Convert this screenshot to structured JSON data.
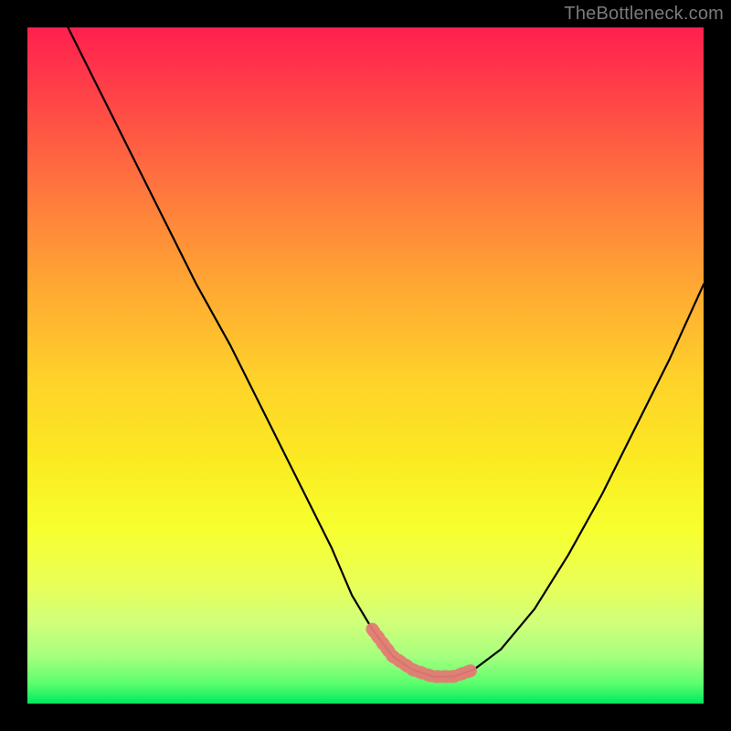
{
  "watermark": "TheBottleneck.com",
  "chart_data": {
    "type": "line",
    "title": "",
    "xlabel": "",
    "ylabel": "",
    "xlim": [
      0,
      100
    ],
    "ylim": [
      0,
      100
    ],
    "series": [
      {
        "name": "curve",
        "x": [
          6,
          10,
          15,
          20,
          25,
          30,
          35,
          40,
          45,
          48,
          51,
          54,
          57,
          60,
          63,
          66,
          70,
          75,
          80,
          85,
          90,
          95,
          100
        ],
        "y": [
          100,
          92,
          82,
          72,
          62,
          53,
          43,
          33,
          23,
          16,
          11,
          7,
          5,
          4,
          4,
          5,
          8,
          14,
          22,
          31,
          41,
          51,
          62
        ]
      }
    ],
    "highlight_band": {
      "name": "bottom-fuzzy-segment",
      "x": [
        51,
        54,
        57,
        60,
        63,
        66
      ],
      "y": [
        11,
        7,
        5,
        4,
        4,
        5
      ],
      "color": "#e47a74"
    },
    "background_gradient_stops": [
      {
        "pos": 0,
        "color": "#ff1f4f"
      },
      {
        "pos": 25,
        "color": "#ff7a3d"
      },
      {
        "pos": 52,
        "color": "#ffd22a"
      },
      {
        "pos": 74,
        "color": "#f7ff2e"
      },
      {
        "pos": 93,
        "color": "#a6ff7e"
      },
      {
        "pos": 100,
        "color": "#00e85e"
      }
    ]
  }
}
